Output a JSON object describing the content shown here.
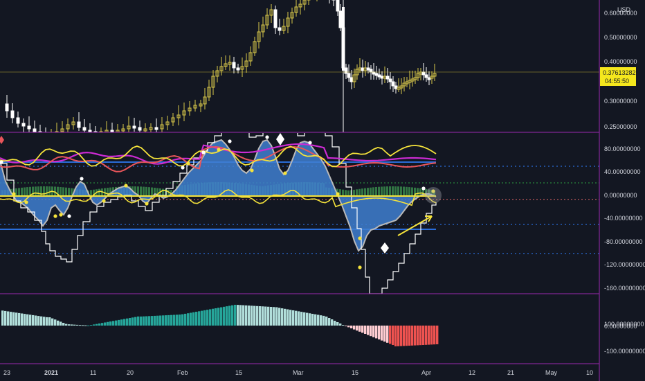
{
  "colors": {
    "background": "#131722",
    "separator": "#9b28b0",
    "price_line": "#e6d23b",
    "candle_up": "#d9c84a",
    "candle_down": "#ffffff",
    "price_tag_bg": "#f5e71d",
    "osc_area": "#3f7fd0",
    "osc_outline": "#b9b9b9",
    "osc_yellow": "#f5e33b",
    "osc_red": "#e8555a",
    "osc_magenta": "#cc2bd3",
    "osc_blue_line": "#2a6dd9",
    "osc_green_dotted": "#2ea043",
    "osc_red_dotted": "#e96a6a",
    "osc_green_hist": "#3b8f4d",
    "step_line": "#ffffff",
    "hist_teal": "#26a69a",
    "hist_light_teal": "#b2dfdb",
    "hist_light_red": "#ffcdd2",
    "hist_red": "#ef5350",
    "arrow": "#f5e33b"
  },
  "price_pane": {
    "currency": "USD",
    "ticks": [
      "0.60000000",
      "0.50000000",
      "0.40000000",
      "0.30000000",
      "0.25000000"
    ],
    "last_price": "0.37613282",
    "countdown": "04:55:50"
  },
  "oscillator_pane": {
    "ticks": [
      "80.00000000",
      "40.00000000",
      "0.00000000",
      "-40.00000000",
      "-80.00000000",
      "-120.00000000",
      "-160.00000000"
    ]
  },
  "histogram_pane": {
    "ticks": [
      "100.00000000",
      "0.00000000",
      "-100.00000000"
    ]
  },
  "time_axis": {
    "labels": [
      "23",
      "2021",
      "11",
      "20",
      "Feb",
      "15",
      "Mar",
      "15",
      "Apr",
      "12",
      "21",
      "May",
      "10"
    ],
    "bold_labels": [
      "2021"
    ]
  },
  "icons": [
    "diamond-marker-icon",
    "arrow-up-right-icon",
    "circle-highlight-icon"
  ]
}
